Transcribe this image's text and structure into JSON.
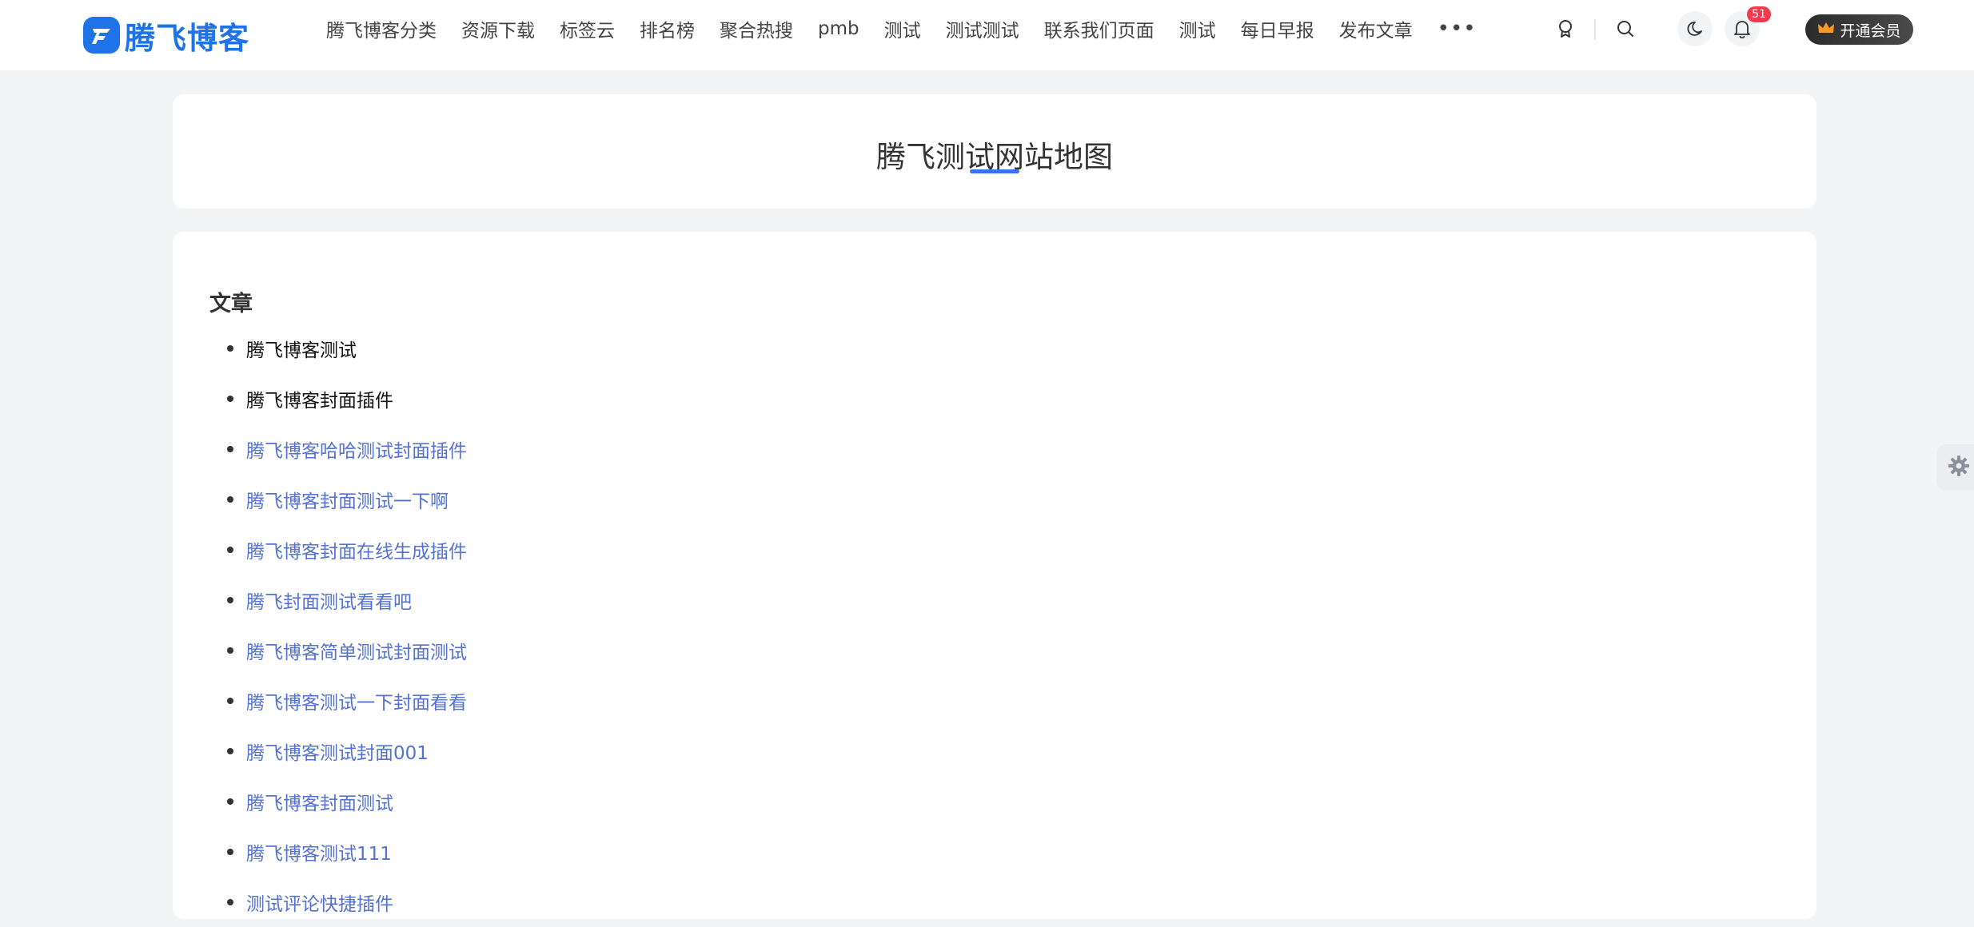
{
  "header": {
    "logo_text": "腾飞博客",
    "nav_items": [
      "腾飞博客分类",
      "资源下载",
      "标签云",
      "排名榜",
      "聚合热搜",
      "pmb",
      "测试",
      "测试测试",
      "联系我们页面",
      "测试",
      "每日早报",
      "发布文章"
    ],
    "more_label": "•••",
    "notification_count": "51",
    "vip_label": "开通会员"
  },
  "page": {
    "title": "腾飞测试网站地图",
    "section_title": "文章",
    "articles": [
      {
        "label": "腾飞博客测试",
        "visited": true
      },
      {
        "label": "腾飞博客封面插件",
        "visited": true
      },
      {
        "label": "腾飞博客哈哈测试封面插件",
        "visited": false
      },
      {
        "label": "腾飞博客封面测试一下啊",
        "visited": false
      },
      {
        "label": "腾飞博客封面在线生成插件",
        "visited": false
      },
      {
        "label": "腾飞封面测试看看吧",
        "visited": false
      },
      {
        "label": "腾飞博客简单测试封面测试",
        "visited": false
      },
      {
        "label": "腾飞博客测试一下封面看看",
        "visited": false
      },
      {
        "label": "腾飞博客测试封面001",
        "visited": false
      },
      {
        "label": "腾飞博客封面测试",
        "visited": false
      },
      {
        "label": "腾飞博客测试111",
        "visited": false
      },
      {
        "label": "测试评论快捷插件",
        "visited": false
      }
    ]
  },
  "colors": {
    "brand": "#1e73e8",
    "link": "#5472d4",
    "accent_underline": "#3e6ff0",
    "badge": "#f43a4e"
  },
  "icons": {
    "logo": "feather-logo-icon",
    "medal": "medal-icon",
    "search": "search-icon",
    "dark_mode": "moon-icon",
    "notifications": "bell-icon",
    "vip": "crown-icon",
    "settings": "gear-icon"
  }
}
